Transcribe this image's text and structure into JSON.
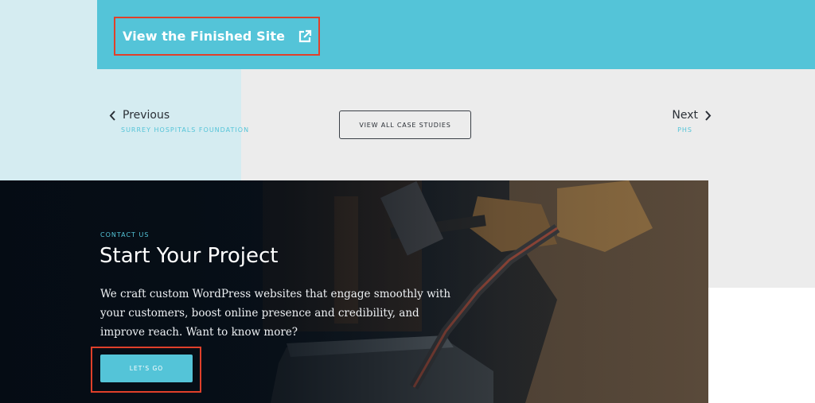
{
  "banner": {
    "link_label": "View the Finished Site",
    "link_icon": "external-link-icon",
    "accent_color": "#54c4d8"
  },
  "case_nav": {
    "previous": {
      "label": "Previous",
      "subtitle": "SURREY HOSPITALS FOUNDATION",
      "icon": "chevron-left-icon"
    },
    "view_all_label": "VIEW ALL CASE STUDIES",
    "next": {
      "label": "Next",
      "subtitle": "PHS",
      "icon": "chevron-right-icon"
    }
  },
  "contact": {
    "eyebrow": "CONTACT US",
    "title": "Start Your Project",
    "body": "We craft custom WordPress websites that engage smoothly with your customers, boost online presence and credibility, and improve reach. Want to know more?",
    "button_label": "LET'S GO",
    "background_image": "blacksmith-forging-photo"
  },
  "highlight_color": "#e0402a"
}
